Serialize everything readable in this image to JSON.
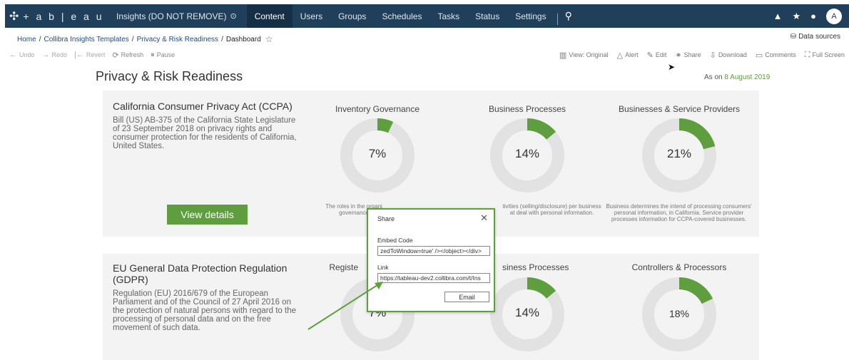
{
  "topnav": {
    "logo": "+ a b | e a u",
    "site": "Insights (DO NOT REMOVE)",
    "items": [
      {
        "label": "Content",
        "active": true
      },
      {
        "label": "Users",
        "active": false
      },
      {
        "label": "Groups",
        "active": false
      },
      {
        "label": "Schedules",
        "active": false
      },
      {
        "label": "Tasks",
        "active": false
      },
      {
        "label": "Status",
        "active": false
      },
      {
        "label": "Settings",
        "active": false
      }
    ],
    "avatar": "A"
  },
  "breadcrumb": {
    "items": [
      "Home",
      "Collibra Insights Templates",
      "Privacy & Risk Readiness"
    ],
    "current": "Dashboard"
  },
  "data_sources": "Data sources",
  "toolbar": {
    "undo": "Undo",
    "redo": "Redo",
    "revert": "Revert",
    "refresh": "Refresh",
    "pause": "Pause",
    "view": "View: Original",
    "alert": "Alert",
    "edit": "Edit",
    "share": "Share",
    "download": "Download",
    "comments": "Comments",
    "fullscreen": "Full Screen"
  },
  "dashboard": {
    "title": "Privacy & Risk Readiness",
    "as_of_prefix": "As on",
    "as_of_date": "8 August 2019",
    "accent": "#5e9e3f",
    "ccpa": {
      "title": "California Consumer Privacy Act (CCPA)",
      "desc1": "Bill (US) AB-375 of the California State Legislature",
      "desc2": "of 23 September 2018 on privacy rights and",
      "desc3": "consumer protection for the residents of California,",
      "desc4": "United States.",
      "button": "View details",
      "metrics": [
        {
          "title": "Inventory Governance",
          "pct": "7%",
          "value": 7,
          "cap1": "The roles in the organi",
          "cap2": "governance"
        },
        {
          "title": "Business Processes",
          "pct": "14%",
          "value": 14,
          "cap1": "tivities (selling/disclosure) per business",
          "cap2": "at deal with personal information."
        },
        {
          "title": "Businesses & Service Providers",
          "pct": "21%",
          "value": 21,
          "cap1": "Business determines the intend of processing consumers'",
          "cap2": "personal information, in California. Service provider",
          "cap3": "processes information for CCPA-covered businesses."
        }
      ]
    },
    "gdpr": {
      "title1": "EU General Data Protection Regulation",
      "title2": "(GDPR)",
      "desc1": "Regulation (EU) 2016/679 of the European",
      "desc2": "Parliament and of the Council of 27 April 2016 on",
      "desc3": "the protection of natural persons with regard to the",
      "desc4": "processing of personal data and on the free",
      "desc5": "movement of such data.",
      "metrics": [
        {
          "title": "Registe",
          "pct": "7%",
          "value": 7
        },
        {
          "title": "siness Processes",
          "pct": "14%",
          "value": 14
        },
        {
          "title": "Controllers & Processors",
          "pct": "18%",
          "value": 18
        }
      ]
    }
  },
  "share_dialog": {
    "title": "Share",
    "embed_label": "Embed Code",
    "embed_value": "zedToWindow=true' /></object></div>",
    "link_label": "Link",
    "link_value": "https://tableau-dev2.collibra.com/t/Ins",
    "email_button": "Email"
  }
}
